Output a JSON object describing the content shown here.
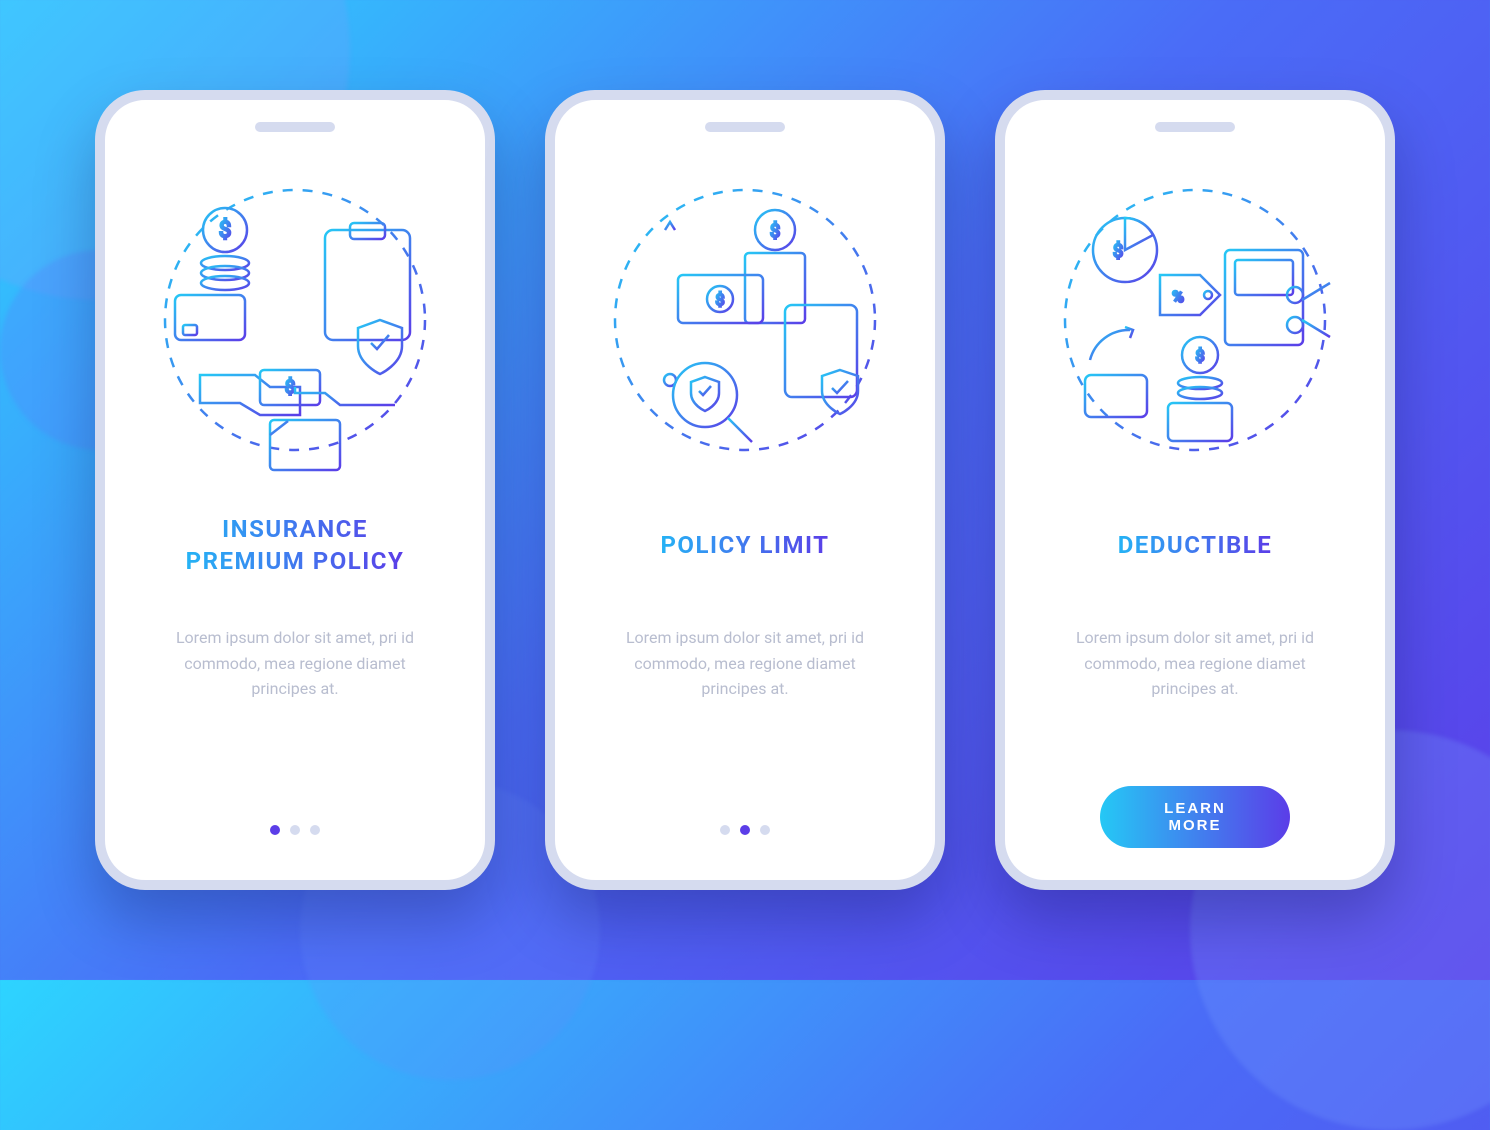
{
  "screens": [
    {
      "title": "INSURANCE\nPREMIUM POLICY",
      "description": "Lorem ipsum dolor sit amet, pri id commodo, mea regione diamet principes at.",
      "active_dot": 0,
      "has_cta": false
    },
    {
      "title": "POLICY LIMIT",
      "description": "Lorem ipsum dolor sit amet, pri id commodo, mea regione diamet principes at.",
      "active_dot": 1,
      "has_cta": false
    },
    {
      "title": "DEDUCTIBLE",
      "description": "Lorem ipsum dolor sit amet, pri id commodo, mea regione diamet principes at.",
      "active_dot": 2,
      "has_cta": true
    }
  ],
  "cta_label": "LEARN MORE",
  "colors": {
    "gradient_start": "#25c8f5",
    "gradient_end": "#5b3de8",
    "inactive_dot": "#d5dbef",
    "desc_text": "#b8bdcf"
  }
}
